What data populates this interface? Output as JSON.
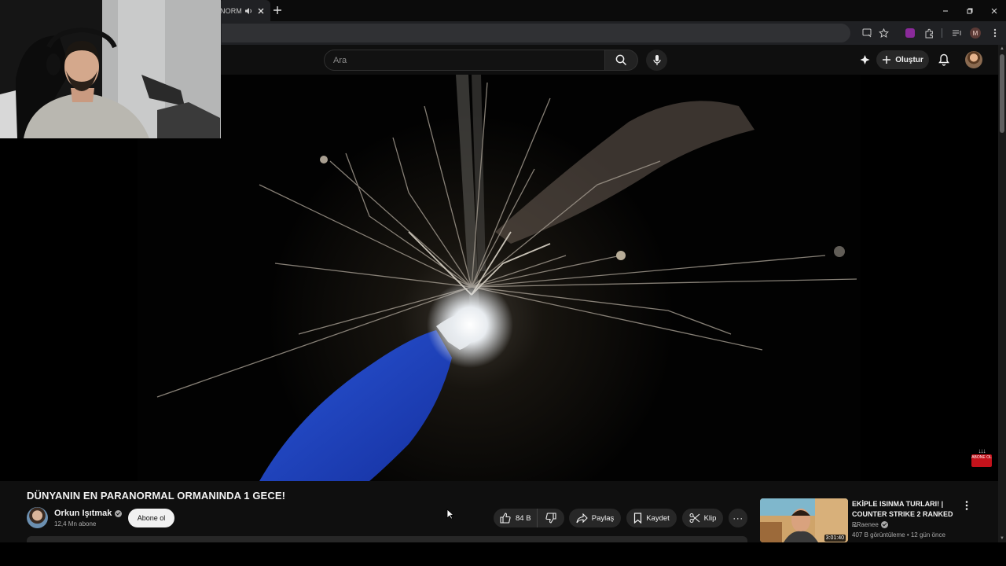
{
  "browser": {
    "tab_title": "NORM",
    "profile_initial": "M"
  },
  "header": {
    "search_placeholder": "Ara",
    "create_label": "Oluştur"
  },
  "video": {
    "title": "DÜNYANIN EN PARANORMAL ORMANINDA 1 GECE!",
    "watermark_text": "ABONE OL"
  },
  "channel": {
    "name": "Orkun Işıtmak",
    "subscribers": "12,4 Mn abone",
    "subscribe_label": "Abone ol"
  },
  "actions": {
    "likes": "84 B",
    "share_label": "Paylaş",
    "save_label": "Kaydet",
    "clip_label": "Klip",
    "more_label": "···"
  },
  "recommendation": {
    "title": "EKİPLE ISINMA TURLARI! | COUNTER STRIKE 2 RANKED ...",
    "channel": "RRaenee",
    "meta": "407 B görüntüleme • 12 gün önce",
    "duration": "3:01:40"
  },
  "colors": {
    "background": "#0f0f0f",
    "chip": "#272727",
    "subscribe_bg": "#f1f1f1",
    "watermark_red": "#c4121b",
    "browser_toolbar": "#202124"
  }
}
